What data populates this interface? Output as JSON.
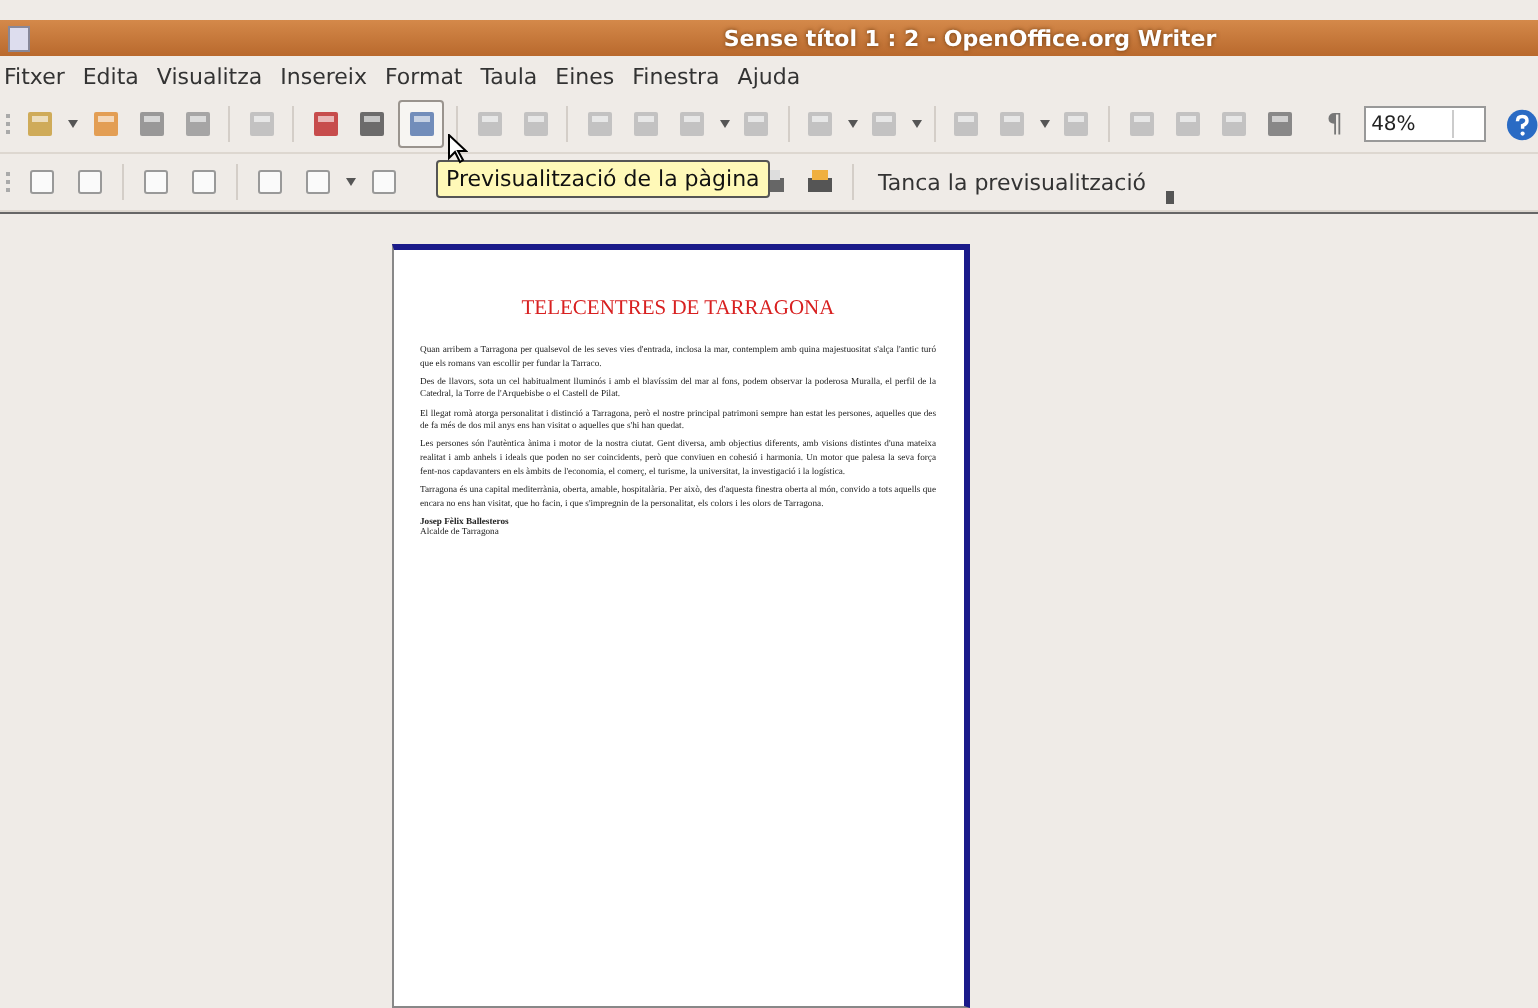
{
  "window": {
    "title": "Sense títol 1 : 2 - OpenOffice.org Writer"
  },
  "menu": [
    {
      "label": "Fitxer"
    },
    {
      "label": "Edita"
    },
    {
      "label": "Visualitza"
    },
    {
      "label": "Insereix"
    },
    {
      "label": "Format"
    },
    {
      "label": "Taula"
    },
    {
      "label": "Eines"
    },
    {
      "label": "Finestra"
    },
    {
      "label": "Ajuda"
    }
  ],
  "toolbar": {
    "pilcrow": "¶",
    "zoom": "48%"
  },
  "preview_toolbar": {
    "close_button": "Tanca la previsualització"
  },
  "tooltip": "Previsualització de la pàgina",
  "document": {
    "title": "TELECENTRES DE TARRAGONA",
    "paragraphs": [
      "Quan arribem a Tarragona per qualsevol de les seves vies d'entrada, inclosa la mar, contemplem amb quina majestuositat s'alça l'antic turó que els romans van escollir per fundar la Tarraco.",
      "Des de llavors, sota un cel habitualment lluminós i amb el blavíssim del mar al fons, podem observar la poderosa Muralla, el perfil de la Catedral, la Torre de l'Arquebisbe o el Castell de Pilat.",
      "El llegat romà atorga personalitat i distinció a Tarragona, però el nostre principal patrimoni sempre han estat les persones, aquelles que des de fa més de dos mil anys ens han visitat o aquelles que s'hi han quedat.",
      "Les persones són l'autèntica ànima i motor de la nostra ciutat. Gent diversa, amb objectius diferents, amb visions distintes d'una mateixa realitat i amb anhels i ideals que poden no ser coincidents, però que conviuen en cohesió i harmonia. Un motor que palesa la seva força fent-nos capdavanters en els àmbits de l'economia, el comerç, el turisme, la universitat, la investigació i la logística.",
      "Tarragona és una capital mediterrània, oberta, amable, hospitalària. Per això, des d'aquesta finestra oberta al món, convido a tots aquells que encara no ens han visitat, que ho facin, i que s'impregnin de la personalitat, els colors i les olors de Tarragona."
    ],
    "signature": {
      "name": "Josep Fèlix Ballesteros",
      "role": "Alcalde de Tarragona"
    }
  }
}
